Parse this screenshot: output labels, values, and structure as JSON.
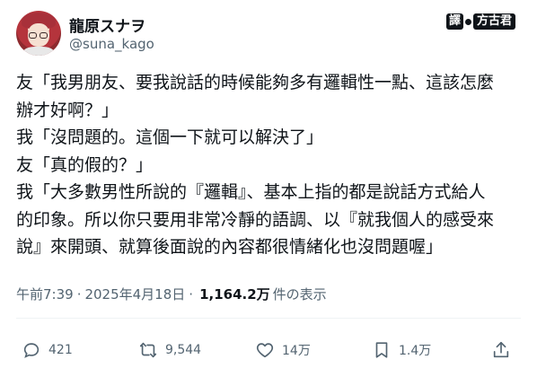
{
  "author": {
    "display_name": "龍原スナヲ",
    "handle": "@suna_kago"
  },
  "watermark": {
    "part1": "譯",
    "part2": "方古君"
  },
  "tweet": {
    "lines": [
      "友「我男朋友、要我說話的時候能夠多有邏輯性一點、這該怎麼",
      "辦才好啊？」",
      "我「沒問題的。這個一下就可以解決了」",
      "友「真的假的？」",
      "我「大多數男性所說的『邏輯』、基本上指的都是說話方式給人",
      "的印象。所以你只要用非常冷靜的語調、以『就我個人的感受來",
      "說』來開頭、就算後面說的內容都很情緒化也沒問題喔」"
    ]
  },
  "meta": {
    "time": "午前7:39",
    "separator1": "·",
    "date": "2025年4月18日",
    "separator2": "·",
    "views": "1,164.2万",
    "views_suffix": "件の表示"
  },
  "actions": {
    "reply_count": "421",
    "retweet_count": "9,544",
    "like_count": "14万",
    "bookmark_count": "1.4万"
  },
  "icons": {
    "reply": "reply-icon",
    "retweet": "retweet-icon",
    "like": "heart-icon",
    "bookmark": "bookmark-icon",
    "share": "share-icon"
  },
  "colors": {
    "text": "#0f1419",
    "secondary": "#536471",
    "divider": "#eff3f4"
  }
}
